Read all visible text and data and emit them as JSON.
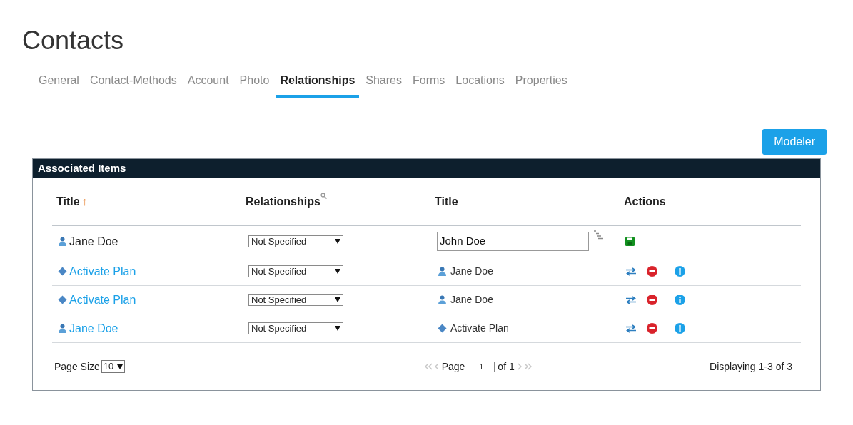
{
  "page": {
    "title": "Contacts"
  },
  "tabs": [
    {
      "label": "General",
      "selected": false
    },
    {
      "label": "Contact-Methods",
      "selected": false
    },
    {
      "label": "Account",
      "selected": false
    },
    {
      "label": "Photo",
      "selected": false
    },
    {
      "label": "Relationships",
      "selected": true
    },
    {
      "label": "Shares",
      "selected": false
    },
    {
      "label": "Forms",
      "selected": false
    },
    {
      "label": "Locations",
      "selected": false
    },
    {
      "label": "Properties",
      "selected": false
    }
  ],
  "modeler_button": "Modeler",
  "panel": {
    "title": "Associated Items",
    "columns": [
      {
        "label": "Title",
        "sort_mark": "↑"
      },
      {
        "label": "Relationships"
      },
      {
        "label": "Title"
      },
      {
        "label": "Actions"
      }
    ],
    "rows": [
      {
        "kind": "edit",
        "title": {
          "kind": "person",
          "text": "Jane Doe",
          "link": false
        },
        "relationship": "Not Specified",
        "related": {
          "kind": "input",
          "text": "John Doe"
        }
      },
      {
        "kind": "view",
        "title": {
          "kind": "plan",
          "text": "Activate Plan",
          "link": true
        },
        "relationship": "Not Specified",
        "related": {
          "kind": "person",
          "text": "Jane Doe"
        }
      },
      {
        "kind": "view",
        "title": {
          "kind": "plan",
          "text": "Activate Plan",
          "link": true
        },
        "relationship": "Not Specified",
        "related": {
          "kind": "person",
          "text": "Jane Doe"
        }
      },
      {
        "kind": "view",
        "title": {
          "kind": "person",
          "text": "Jane Doe",
          "link": true
        },
        "relationship": "Not Specified",
        "related": {
          "kind": "plan",
          "text": "Activate Plan"
        }
      }
    ],
    "footer": {
      "page_size_label": "Page Size",
      "page_size": "10",
      "page_label": "Page",
      "page": "1",
      "of_label": "of 1",
      "summary": "Displaying 1-3 of 3"
    }
  }
}
